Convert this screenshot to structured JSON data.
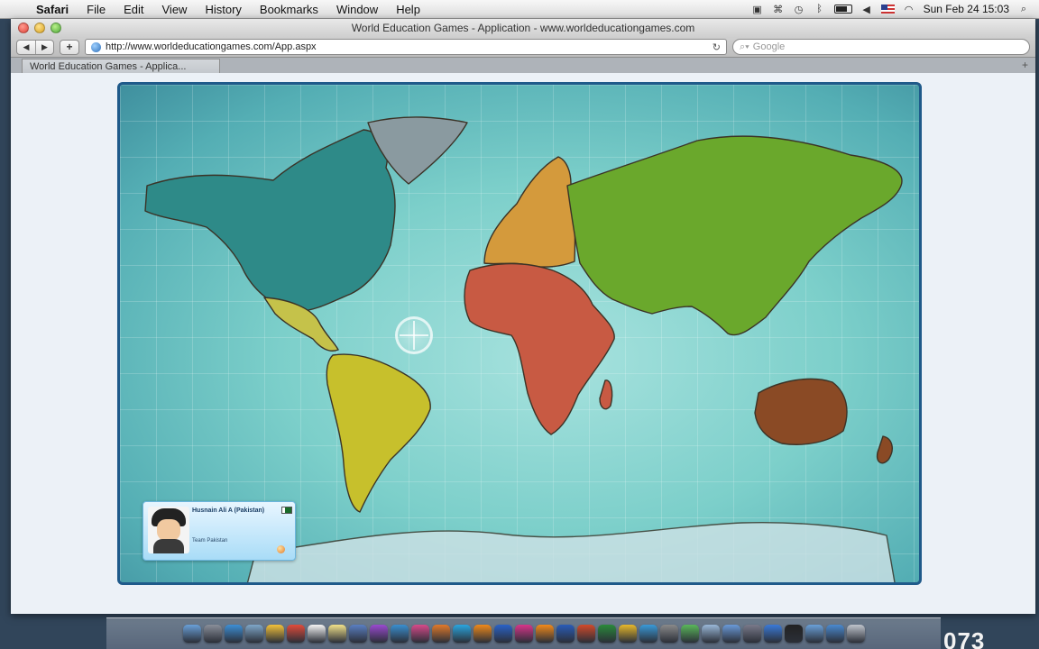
{
  "menubar": {
    "apple_symbol": "",
    "items": [
      "Safari",
      "File",
      "Edit",
      "View",
      "History",
      "Bookmarks",
      "Window",
      "Help"
    ],
    "clock": "Sun Feb 24  15:03",
    "status_icons": [
      "screen-recorder-icon",
      "wifi-tether-icon",
      "time-machine-icon",
      "bluetooth-icon",
      "battery-icon",
      "volume-icon",
      "flag-us-icon",
      "wifi-icon",
      "spotlight-icon"
    ]
  },
  "window": {
    "title": "World Education Games - Application - www.worldeducationgames.com",
    "address_url": "http://www.worldeducationgames.com/App.aspx",
    "search_placeholder": "Google",
    "tab_label": "World Education Games - Applica..."
  },
  "game": {
    "map_type": "world-map",
    "player": {
      "name": "Husnain Ali A (Pakistan)",
      "team": "Team Pakistan",
      "flag": "pakistan"
    },
    "continent_colors": {
      "north_america": "#2e8a88",
      "central_america": "#c5c24a",
      "south_america": "#c7c02c",
      "greenland": "#8a9aa0",
      "europe": "#d49a3c",
      "africa": "#c85a43",
      "asia": "#6aa82c",
      "australia": "#8a4a25",
      "antarctica": "#cfe2e6"
    }
  },
  "corner_label": "073",
  "dock_icons": [
    "finder-icon",
    "system-prefs-icon",
    "safari-icon",
    "preview-icon",
    "smiley-icon",
    "chrome-icon",
    "calendar-icon",
    "notes-icon",
    "photos-icon",
    "purple-app-icon",
    "iphoto-icon",
    "itunes-icon",
    "firefox-icon",
    "skype-icon",
    "illustrator-icon",
    "photoshop-icon",
    "indesign-icon",
    "vlc-icon",
    "word-icon",
    "powerpoint-icon",
    "excel-icon",
    "outlook-icon",
    "globe-icon",
    "tools-icon",
    "maps-icon",
    "preview2-icon",
    "mail-icon",
    "network-icon",
    "app-store-icon",
    "terminal-icon",
    "folder-icon",
    "downloads-icon",
    "trash-icon"
  ]
}
